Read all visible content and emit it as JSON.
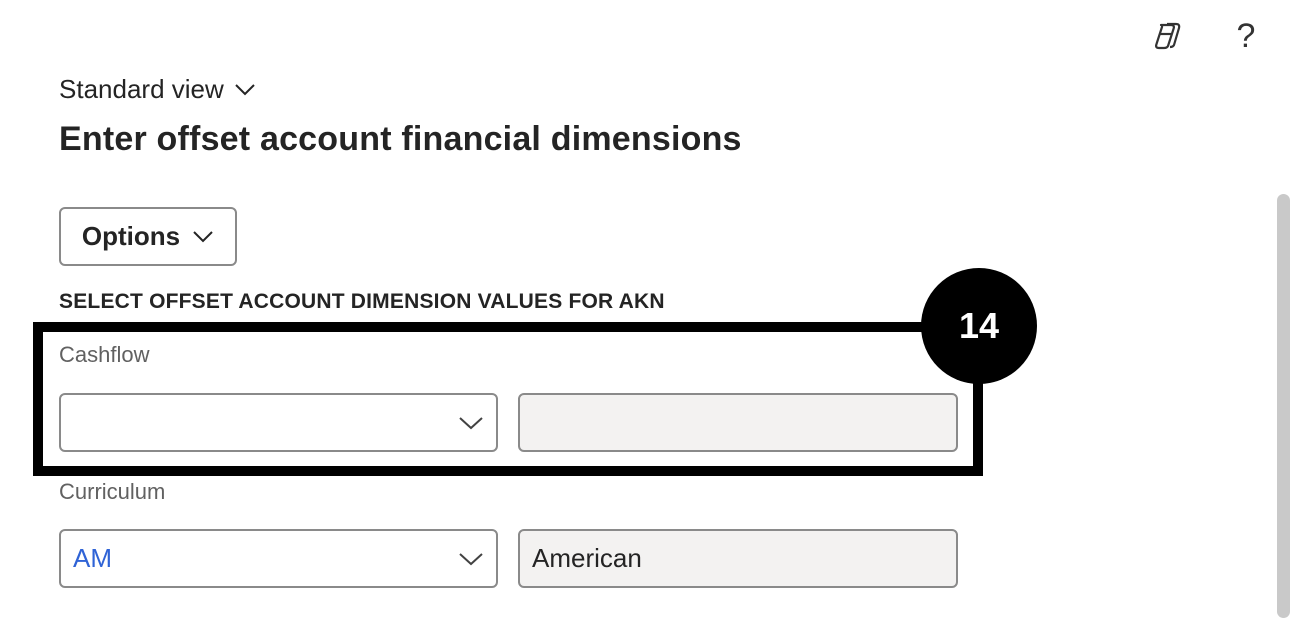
{
  "header": {
    "copilot_icon": "copilot-icon",
    "help_icon": "help-icon",
    "help_glyph": "?"
  },
  "view": {
    "label": "Standard view"
  },
  "page": {
    "title": "Enter offset account financial dimensions"
  },
  "toolbar": {
    "options_label": "Options"
  },
  "section": {
    "heading": "SELECT OFFSET ACCOUNT DIMENSION VALUES FOR AKN"
  },
  "fields": [
    {
      "label": "Cashflow",
      "value": "",
      "description": ""
    },
    {
      "label": "Curriculum",
      "value": "AM",
      "description": "American"
    }
  ],
  "callout": {
    "step_number": "14"
  },
  "colors": {
    "accent_link": "#2f63d6",
    "highlight": "#000000",
    "readonly_bg": "#f3f2f1"
  }
}
